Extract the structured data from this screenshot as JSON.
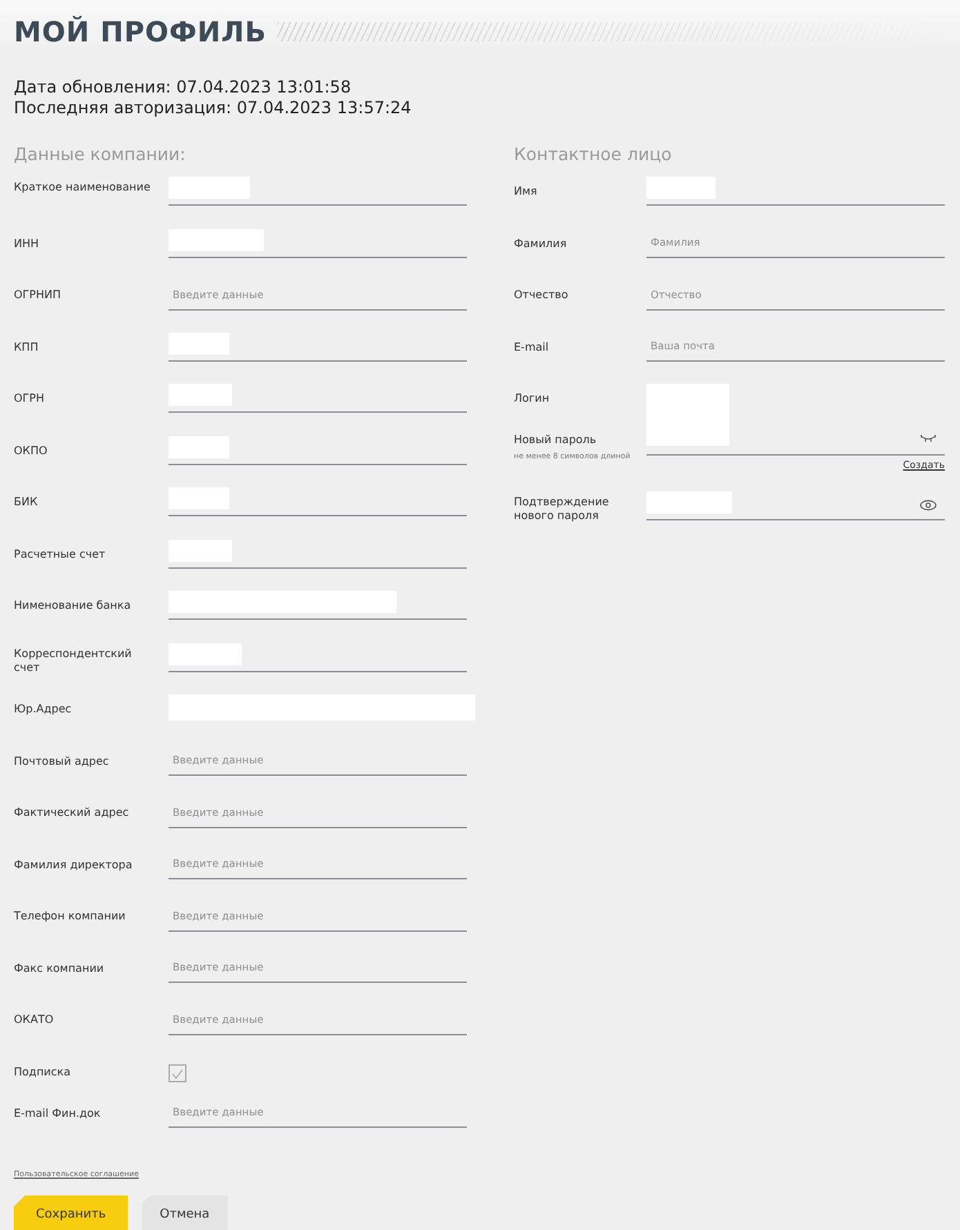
{
  "title": "МОЙ ПРОФИЛЬ",
  "meta": [
    "Дата обновления: 07.04.2023 13:01:58",
    "Последняя авторизация: 07.04.2023 13:57:24"
  ],
  "company": {
    "heading": "Данные компании:",
    "fields": [
      {
        "label": "Краткое наименование",
        "kind": "input",
        "redacted": true
      },
      {
        "label": "ИНН",
        "kind": "input",
        "redacted": true
      },
      {
        "label": "ОГРНИП",
        "kind": "input",
        "placeholder": "Введите данные"
      },
      {
        "label": "КПП",
        "kind": "input",
        "redacted": true
      },
      {
        "label": "ОГРН",
        "kind": "input",
        "redacted": true
      },
      {
        "label": "ОКПО",
        "kind": "input",
        "redacted": true
      },
      {
        "label": "БИК",
        "kind": "input",
        "redacted": true
      },
      {
        "label": "Расчетные счет",
        "kind": "input",
        "redacted": true
      },
      {
        "label": "Нименование банка",
        "kind": "input",
        "redacted": true
      },
      {
        "label": "Корреспондентский счет",
        "kind": "input",
        "redacted": true
      },
      {
        "label": "Юр.Адрес",
        "kind": "input",
        "redacted": true
      },
      {
        "label": "Почтовый адрес",
        "kind": "input",
        "placeholder": "Введите данные"
      },
      {
        "label": "Фактический адрес",
        "kind": "input",
        "placeholder": "Введите данные"
      },
      {
        "label": "Фамилия директора",
        "kind": "input",
        "placeholder": "Введите данные"
      },
      {
        "label": "Телефон компании",
        "kind": "input",
        "placeholder": "Введите данные"
      },
      {
        "label": "Факс компании",
        "kind": "input",
        "placeholder": "Введите данные"
      },
      {
        "label": "ОКАТО",
        "kind": "input",
        "placeholder": "Введите данные"
      },
      {
        "label": "Подписка",
        "kind": "checkbox",
        "checked": true
      },
      {
        "label": "E-mail Фин.док",
        "kind": "input",
        "placeholder": "Введите данные"
      }
    ]
  },
  "contact": {
    "heading": "Контактное лицо",
    "fields": [
      {
        "label": "Имя",
        "kind": "input",
        "redacted": true
      },
      {
        "label": "Фамилия",
        "kind": "input",
        "placeholder": "Фамилия"
      },
      {
        "label": "Отчество",
        "kind": "input",
        "placeholder": "Отчество"
      },
      {
        "label": "E-mail",
        "kind": "input",
        "placeholder": "Ваша почта"
      },
      {
        "label": "Логин",
        "kind": "login",
        "redacted": true
      },
      {
        "label": "Новый пароль",
        "kind": "password",
        "hint": "не менее 8 символов длиной",
        "revealed": false,
        "link": "Создать"
      },
      {
        "label": "Подтверждение нового пароля",
        "kind": "password",
        "revealed": true,
        "redacted": true
      }
    ]
  },
  "agreement_link": "Пользовательское соглашение",
  "buttons": [
    {
      "label": "Сохранить",
      "kind": "primary"
    },
    {
      "label": "Отмена",
      "kind": "secondary"
    }
  ]
}
